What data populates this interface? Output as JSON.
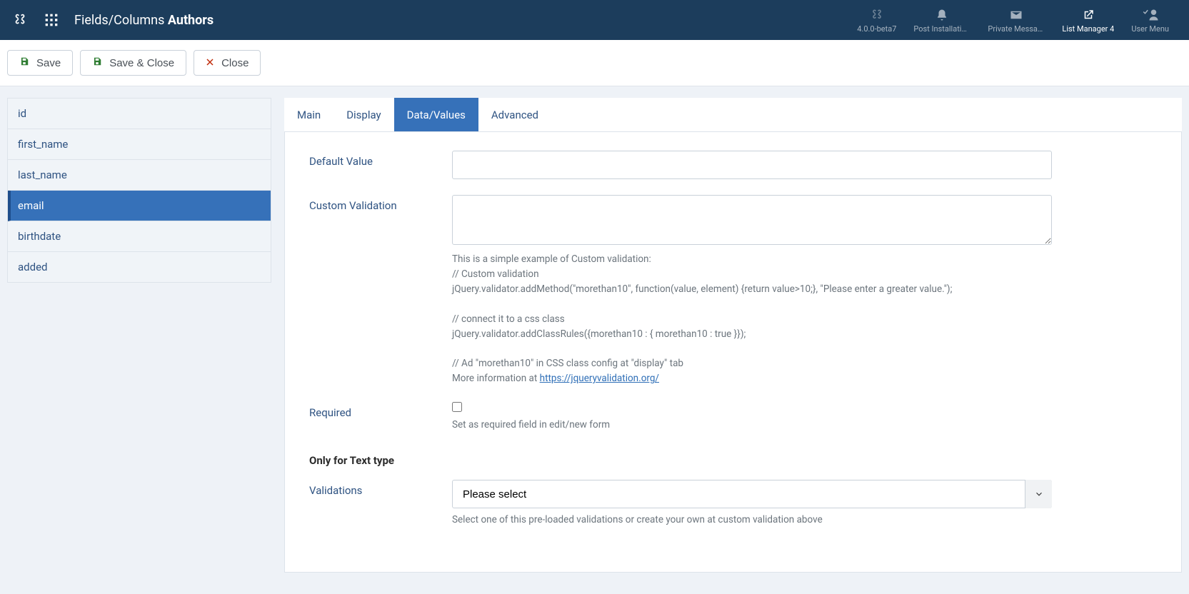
{
  "header": {
    "title_prefix": "Fields/Columns ",
    "title_bold": "Authors",
    "version": "4.0.0-beta7",
    "items": {
      "post_install": "Post Installation ...",
      "private_messages": "Private Messages",
      "list_manager": "List Manager 4",
      "user_menu": "User Menu"
    }
  },
  "toolbar": {
    "save": "Save",
    "save_close": "Save & Close",
    "close": "Close"
  },
  "sidebar": {
    "items": [
      {
        "label": "id",
        "active": false
      },
      {
        "label": "first_name",
        "active": false
      },
      {
        "label": "last_name",
        "active": false
      },
      {
        "label": "email",
        "active": true
      },
      {
        "label": "birthdate",
        "active": false
      },
      {
        "label": "added",
        "active": false
      }
    ]
  },
  "tabs": [
    {
      "label": "Main",
      "active": false
    },
    {
      "label": "Display",
      "active": false
    },
    {
      "label": "Data/Values",
      "active": true
    },
    {
      "label": "Advanced",
      "active": false
    }
  ],
  "form": {
    "default_value": {
      "label": "Default Value",
      "value": ""
    },
    "custom_validation": {
      "label": "Custom Validation",
      "value": "",
      "help_intro": "This is a simple example of Custom validation:",
      "help_l1": "// Custom validation",
      "help_l2": "jQuery.validator.addMethod(\"morethan10\", function(value, element) {return value>10;}, \"Please enter a greater value.\");",
      "help_l3": "// connect it to a css class",
      "help_l4": "jQuery.validator.addClassRules({morethan10 : { morethan10 : true }});",
      "help_l5": "// Ad \"morethan10\" in CSS class config at \"display\" tab",
      "help_more_prefix": "More information at ",
      "help_link": "https://jqueryvalidation.org/"
    },
    "required": {
      "label": "Required",
      "help": "Set as required field in edit/new form",
      "checked": false
    },
    "text_section": "Only for Text type",
    "validations": {
      "label": "Validations",
      "selected": "Please select",
      "help": "Select one of this pre-loaded validations or create your own at custom validation above"
    }
  }
}
